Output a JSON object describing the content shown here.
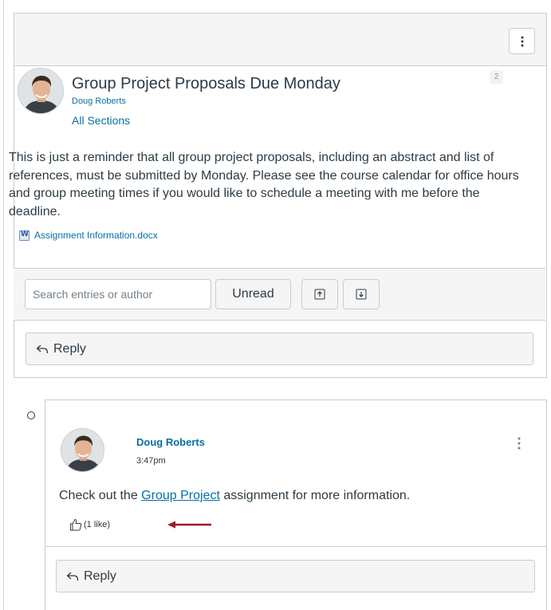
{
  "topic": {
    "title": "Group Project Proposals Due Monday",
    "author": "Doug Roberts",
    "sections": "All Sections",
    "reply_count": "2",
    "body": "This is just a reminder that all group project proposals, including an abstract and list of references, must be submitted by Monday. Please see the course calendar for office hours and group meeting times if you would like to schedule a meeting with me before the deadline.",
    "attachment_name": "Assignment Information.docx",
    "attachment_icon": "word-doc-icon",
    "menu_icon": "kebab-menu-icon"
  },
  "toolbar": {
    "search_placeholder": "Search entries or author",
    "unread_label": "Unread",
    "collapse_icon": "collapse-all-icon",
    "expand_icon": "expand-all-icon"
  },
  "topic_reply": {
    "label": "Reply",
    "icon": "reply-arrow-icon"
  },
  "entry": {
    "author": "Doug Roberts",
    "time": "3:47pm",
    "body_before": "Check out the ",
    "link_text": "Group Project",
    "body_after": " assignment for more information.",
    "like_text": "(1 like)",
    "like_icon": "thumbs-up-icon",
    "reply_label": "Reply",
    "status_icon": "unread-indicator-icon"
  },
  "colors": {
    "link": "#0770a3",
    "text": "#2d3b45",
    "header_bg": "#f5f5f5",
    "border": "#c7cdd1",
    "annotation_arrow": "#9b1c1c"
  }
}
